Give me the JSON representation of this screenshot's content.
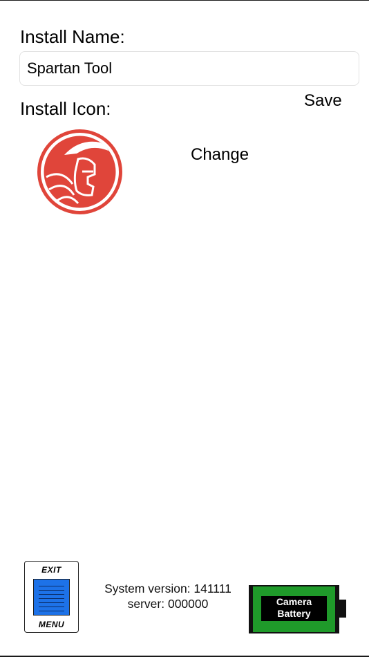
{
  "form": {
    "name_label": "Install Name:",
    "name_value": "Spartan Tool",
    "icon_label": "Install Icon:",
    "save_label": "Save",
    "change_label": "Change"
  },
  "icon": {
    "name": "spartan-helmet-icon",
    "color": "#e0453a"
  },
  "footer": {
    "exit_top": "EXIT",
    "exit_bottom": "MENU",
    "system_version": "System version: 141111",
    "server": "server: 000000",
    "battery_line1": "Camera",
    "battery_line2": "Battery",
    "battery_color": "#1f9a2a"
  }
}
